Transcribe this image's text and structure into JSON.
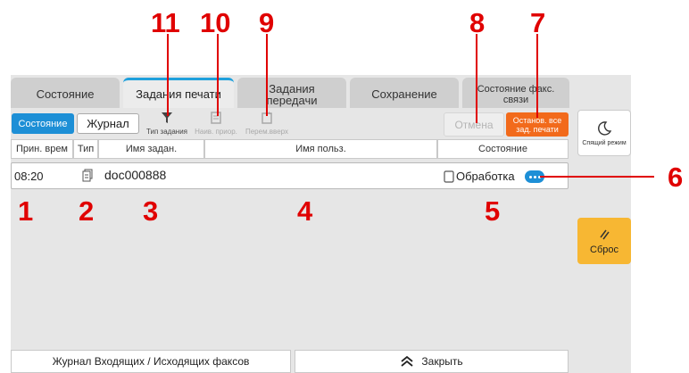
{
  "tabs": [
    {
      "label": "Состояние"
    },
    {
      "label": "Задания печати"
    },
    {
      "label": "Задания передачи"
    },
    {
      "label": "Сохранение"
    },
    {
      "label": "Состояние факс. связи"
    }
  ],
  "toolbar": {
    "status_button": "Состояние",
    "log_button": "Журнал",
    "job_type": "Тип задания",
    "top_priority": "Наив. приор.",
    "move_up": "Перем.вверх",
    "cancel": "Отмена",
    "stop_all": "Останов. все зад. печати"
  },
  "table": {
    "columns": [
      "Прин. врем",
      "Тип",
      "Имя задан.",
      "Имя польз.",
      "Состояние"
    ],
    "rows": [
      {
        "time": "08:20",
        "type_icon": "document-icon",
        "name": "doc000888",
        "user": "",
        "status": "Обработка"
      }
    ]
  },
  "sidebar": {
    "sleep": "Спящий режим",
    "reset": "Сброс"
  },
  "bottom": {
    "fax_log": "Журнал Входящих / Исходящих факсов",
    "close": "Закрыть"
  },
  "callouts": [
    "1",
    "2",
    "3",
    "4",
    "5",
    "6",
    "7",
    "8",
    "9",
    "10",
    "11"
  ],
  "colors": {
    "accent_blue": "#1d8fd6",
    "stop_orange": "#f26a1b",
    "reset_yellow": "#f7b733",
    "callout_red": "#e00000"
  }
}
